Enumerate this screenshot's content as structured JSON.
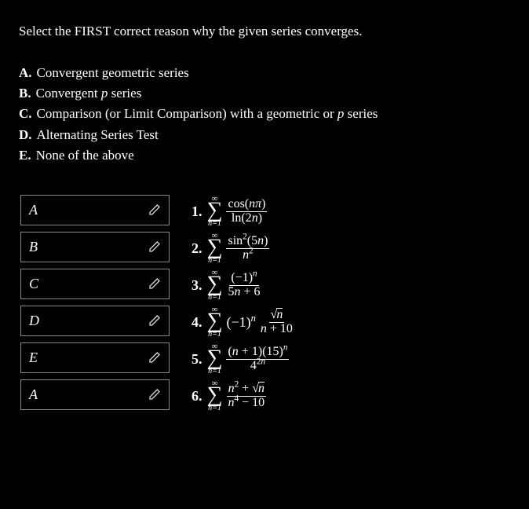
{
  "prompt": "Select the FIRST correct reason why the given series converges.",
  "options": [
    {
      "letter": "A.",
      "text": "Convergent geometric series"
    },
    {
      "letter": "B.",
      "text_pre": "Convergent ",
      "p": "p",
      "text_post": " series"
    },
    {
      "letter": "C.",
      "text_pre": "Comparison (or Limit Comparison) with a geometric or ",
      "p": "p",
      "text_post": " series"
    },
    {
      "letter": "D.",
      "text": "Alternating Series Test"
    },
    {
      "letter": "E.",
      "text": "None of the above"
    }
  ],
  "answers": [
    "A",
    "B",
    "C",
    "D",
    "E",
    "A"
  ],
  "series": [
    {
      "num": "1.",
      "top": "cos(nπ)",
      "bot": "ln(2n)"
    },
    {
      "num": "2.",
      "top": "sin²(5n)",
      "bot": "n²"
    },
    {
      "num": "3.",
      "top": "(−1)ⁿ",
      "bot": "5n + 6"
    },
    {
      "num": "4.",
      "prefix": "(−1)ⁿ",
      "top": "√n",
      "bot": "n + 10"
    },
    {
      "num": "5.",
      "top": "(n + 1)(15)ⁿ",
      "bot": "4²ⁿ"
    },
    {
      "num": "6.",
      "top": "n² + √n",
      "bot": "n⁴ − 10"
    }
  ],
  "sigma": {
    "inf": "∞",
    "sym": "∑",
    "sub": "n=1"
  }
}
